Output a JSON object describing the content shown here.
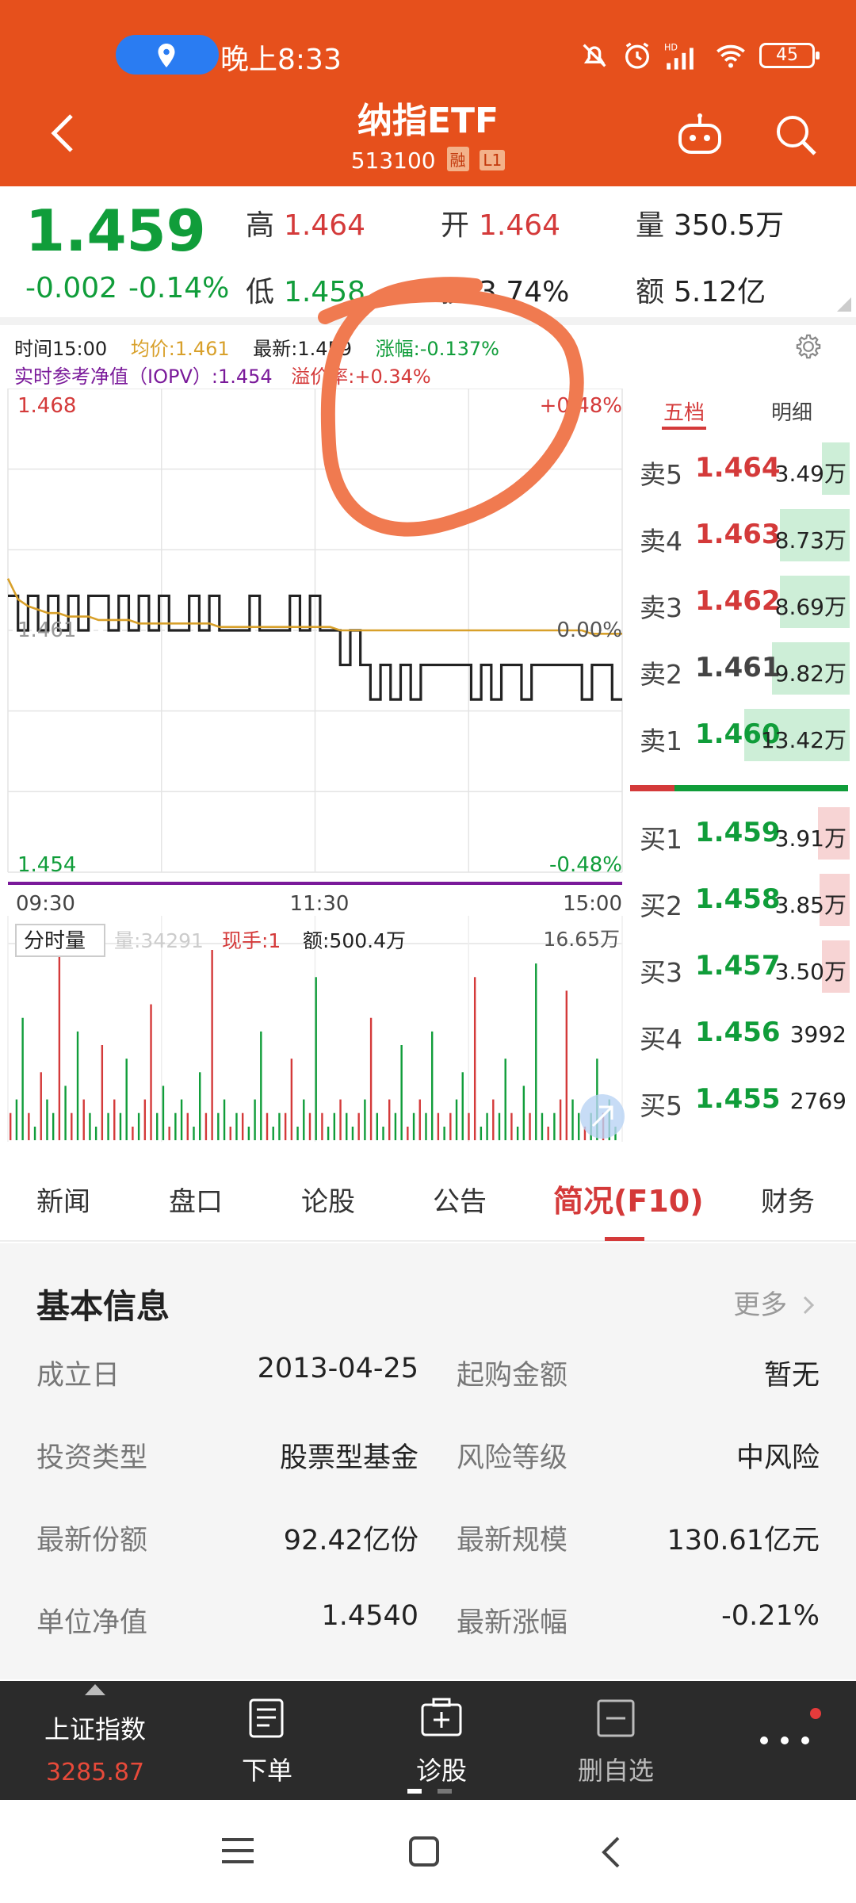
{
  "status_bar": {
    "time": "晚上8:33",
    "battery": "45",
    "network_tag": "HD"
  },
  "header": {
    "title": "纳指ETF",
    "code": "513100",
    "badges": [
      "融",
      "L1"
    ]
  },
  "quote": {
    "last_price": "1.459",
    "change_abs": "-0.002",
    "change_pct": "-0.14%",
    "high_label": "高",
    "high": "1.464",
    "open_label": "开",
    "open": "1.464",
    "volume_label": "量",
    "volume": "350.5万",
    "low_label": "低",
    "low": "1.458",
    "turnover_label": "换",
    "turnover": "3.74%",
    "amount_label": "额",
    "amount": "5.12亿"
  },
  "chart_info": {
    "time": "时间15:00",
    "avg": "均价:1.461",
    "latest": "最新:1.459",
    "change": "涨幅:-0.137%",
    "iopv": "实时参考净值（IOPV）:1.454",
    "premium": "溢价率:+0.34%"
  },
  "chart_data": {
    "type": "line",
    "title": "",
    "y_max_label": "1.468",
    "y_mid_label": "1.461",
    "y_min_label": "1.454",
    "pct_max_label": "+0.48%",
    "pct_mid_label": "0.00%",
    "pct_min_label": "-0.48%",
    "ylim": [
      1.454,
      1.468
    ],
    "x_ticks": [
      "09:30",
      "11:30",
      "15:00"
    ],
    "series": [
      {
        "name": "最新",
        "values": [
          1.462,
          1.461,
          1.462,
          1.461,
          1.462,
          1.461,
          1.462,
          1.461,
          1.462,
          1.462,
          1.461,
          1.462,
          1.461,
          1.462,
          1.461,
          1.462,
          1.461,
          1.461,
          1.462,
          1.461,
          1.462,
          1.461,
          1.461,
          1.461,
          1.462,
          1.461,
          1.461,
          1.461,
          1.462,
          1.461,
          1.462,
          1.461,
          1.461,
          1.46,
          1.461,
          1.46,
          1.459,
          1.46,
          1.459,
          1.46,
          1.459,
          1.46,
          1.46,
          1.46,
          1.46,
          1.46,
          1.459,
          1.46,
          1.459,
          1.46,
          1.46,
          1.459,
          1.46,
          1.46,
          1.46,
          1.46,
          1.46,
          1.459,
          1.46,
          1.46,
          1.459,
          1.459
        ]
      },
      {
        "name": "均价",
        "values": [
          1.4625,
          1.4619,
          1.4617,
          1.4616,
          1.4615,
          1.4615,
          1.4614,
          1.4614,
          1.4614,
          1.4613,
          1.4613,
          1.4613,
          1.4613,
          1.4612,
          1.4612,
          1.4612,
          1.4612,
          1.4612,
          1.4612,
          1.4612,
          1.4612,
          1.4611,
          1.4611,
          1.4611,
          1.4611,
          1.4611,
          1.4611,
          1.4611,
          1.4611,
          1.4611,
          1.4611,
          1.4611,
          1.4611,
          1.461,
          1.461,
          1.461,
          1.461,
          1.461,
          1.461,
          1.461,
          1.461,
          1.461,
          1.461,
          1.461,
          1.461,
          1.461,
          1.461,
          1.461,
          1.461,
          1.461,
          1.461,
          1.461,
          1.461,
          1.461,
          1.461,
          1.461,
          1.461,
          1.461,
          1.4609,
          1.4609,
          1.4609,
          1.4609
        ]
      }
    ],
    "volume_panel": {
      "tab_label": "分时量",
      "volume_label": "量:34291",
      "current_hand": "现手:1",
      "amount": "额:500.4万",
      "max_label": "16.65万",
      "values": [
        2,
        3,
        9,
        2,
        1,
        5,
        3,
        2,
        14,
        4,
        2,
        8,
        3,
        2,
        1,
        7,
        2,
        3,
        2,
        6,
        1,
        2,
        3,
        10,
        2,
        4,
        1,
        2,
        3,
        2,
        1,
        5,
        2,
        14,
        2,
        3,
        1,
        2,
        2,
        1,
        3,
        8,
        2,
        1,
        2,
        2,
        6,
        1,
        3,
        2,
        12,
        2,
        1,
        2,
        3,
        2,
        1,
        2,
        3,
        9,
        2,
        1,
        3,
        2,
        7,
        1,
        2,
        3,
        2,
        8,
        2,
        1,
        2,
        3,
        5,
        2,
        12,
        1,
        2,
        3,
        2,
        6,
        2,
        1,
        4,
        2,
        13,
        2,
        1,
        2,
        3,
        11,
        3,
        2,
        1,
        2,
        6,
        2,
        3,
        1
      ],
      "colors": [
        "r",
        "g",
        "g",
        "r",
        "g",
        "r",
        "g",
        "g",
        "r",
        "g",
        "r",
        "g",
        "r",
        "g",
        "g",
        "r",
        "g",
        "r",
        "g",
        "g",
        "r",
        "g",
        "r",
        "r",
        "g",
        "g",
        "r",
        "g",
        "g",
        "r",
        "g",
        "g",
        "r",
        "r",
        "g",
        "g",
        "r",
        "g",
        "r",
        "g",
        "g",
        "g",
        "r",
        "g",
        "g",
        "r",
        "r",
        "g",
        "g",
        "r",
        "g",
        "r",
        "g",
        "g",
        "r",
        "g",
        "g",
        "r",
        "g",
        "r",
        "g",
        "g",
        "r",
        "g",
        "g",
        "r",
        "g",
        "r",
        "g",
        "g",
        "r",
        "g",
        "r",
        "g",
        "g",
        "r",
        "r",
        "g",
        "g",
        "r",
        "g",
        "g",
        "r",
        "g",
        "g",
        "r",
        "g",
        "g",
        "r",
        "g",
        "r",
        "r",
        "g",
        "g",
        "r",
        "g",
        "g",
        "r",
        "g",
        "g"
      ]
    }
  },
  "order_book": {
    "tabs": [
      "五档",
      "明细"
    ],
    "asks": [
      {
        "label": "卖5",
        "price": "1.464",
        "volume": "3.49万",
        "fill": 0.14
      },
      {
        "label": "卖4",
        "price": "1.463",
        "volume": "8.73万",
        "fill": 0.35
      },
      {
        "label": "卖3",
        "price": "1.462",
        "volume": "8.69万",
        "fill": 0.35
      },
      {
        "label": "卖2",
        "price": "1.461",
        "volume": "9.82万",
        "fill": 0.39
      },
      {
        "label": "卖1",
        "price": "1.460",
        "volume": "13.42万",
        "fill": 0.53
      }
    ],
    "bids": [
      {
        "label": "买1",
        "price": "1.459",
        "volume": "3.91万",
        "fill": 0.16
      },
      {
        "label": "买2",
        "price": "1.458",
        "volume": "3.85万",
        "fill": 0.15
      },
      {
        "label": "买3",
        "price": "1.457",
        "volume": "3.50万",
        "fill": 0.14
      },
      {
        "label": "买4",
        "price": "1.456",
        "volume": "3992",
        "fill": 0.0
      },
      {
        "label": "买5",
        "price": "1.455",
        "volume": "2769",
        "fill": 0.0
      }
    ]
  },
  "info_tabs": [
    "新闻",
    "盘口",
    "论股",
    "公告",
    "简况(F10)",
    "财务"
  ],
  "basic_info": {
    "title": "基本信息",
    "more": "更多",
    "items": [
      {
        "key": "成立日",
        "value": "2013-04-25"
      },
      {
        "key": "起购金额",
        "value": "暂无"
      },
      {
        "key": "投资类型",
        "value": "股票型基金"
      },
      {
        "key": "风险等级",
        "value": "中风险"
      },
      {
        "key": "最新份额",
        "value": "92.42亿份"
      },
      {
        "key": "最新规模",
        "value": "130.61亿元"
      },
      {
        "key": "单位净值",
        "value": "1.4540"
      },
      {
        "key": "最新涨幅",
        "value": "-0.21%"
      }
    ]
  },
  "toolbar": {
    "index_name": "上证指数",
    "index_value": "3285.87",
    "order": "下单",
    "diagnose": "诊股",
    "remove_watch": "删自选",
    "more_icon": "more-dots-icon"
  },
  "colors": {
    "brand": "#e6501c",
    "up": "#d43a3a",
    "down": "#109d3a",
    "price_line": "#222222",
    "avg_line": "#d8a02a",
    "annotation": "#f07a50"
  }
}
